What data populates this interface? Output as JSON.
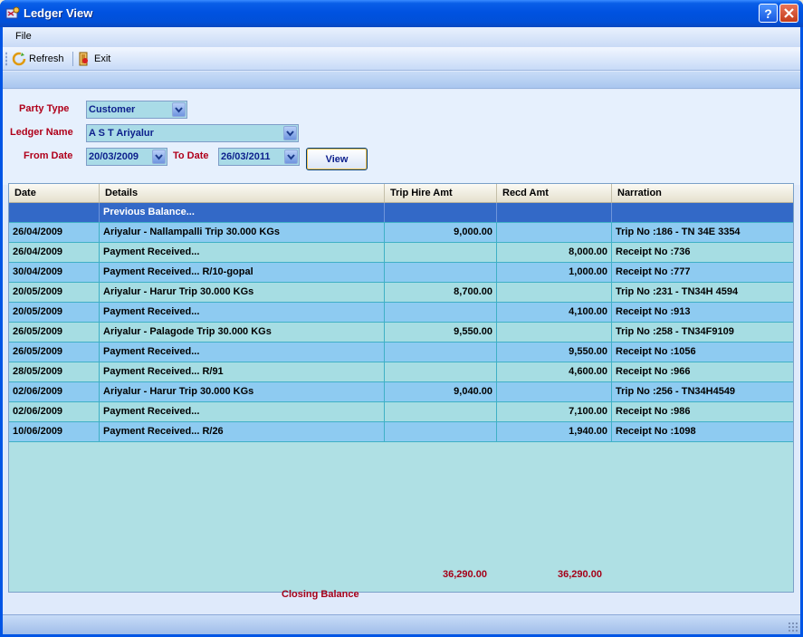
{
  "window": {
    "title": "Ledger View"
  },
  "menu": {
    "file": "File"
  },
  "toolbar": {
    "refresh": "Refresh",
    "exit": "Exit"
  },
  "form": {
    "party_type_label": "Party Type",
    "party_type_value": "Customer",
    "ledger_name_label": "Ledger Name",
    "ledger_name_value": "A S T Ariyalur",
    "from_date_label": "From Date",
    "from_date_value": "20/03/2009",
    "to_date_label": "To Date",
    "to_date_value": "26/03/2011",
    "view_button": "View"
  },
  "grid": {
    "columns": {
      "date": "Date",
      "details": "Details",
      "trip_hire_amt": "Trip Hire Amt",
      "recd_amt": "Recd Amt",
      "narration": "Narration"
    },
    "rows": [
      {
        "date": "",
        "details": "Previous Balance...",
        "trip": "",
        "recd": "",
        "narration": "",
        "style": "sel"
      },
      {
        "date": "26/04/2009",
        "details": "Ariyalur - Nallampalli Trip 30.000 KGs",
        "trip": "9,000.00",
        "recd": "",
        "narration": "Trip No :186 - TN 34E 3354",
        "style": "blue"
      },
      {
        "date": "26/04/2009",
        "details": "Payment Received...",
        "trip": "",
        "recd": "8,000.00",
        "narration": "Receipt No :736",
        "style": "teal"
      },
      {
        "date": "30/04/2009",
        "details": "Payment Received... R/10-gopal",
        "trip": "",
        "recd": "1,000.00",
        "narration": "Receipt No :777",
        "style": "blue"
      },
      {
        "date": "20/05/2009",
        "details": "Ariyalur - Harur Trip 30.000 KGs",
        "trip": "8,700.00",
        "recd": "",
        "narration": "Trip No :231 - TN34H 4594",
        "style": "teal"
      },
      {
        "date": "20/05/2009",
        "details": "Payment Received...",
        "trip": "",
        "recd": "4,100.00",
        "narration": "Receipt No :913",
        "style": "blue"
      },
      {
        "date": "26/05/2009",
        "details": "Ariyalur - Palagode Trip 30.000 KGs",
        "trip": "9,550.00",
        "recd": "",
        "narration": "Trip No :258 - TN34F9109",
        "style": "teal"
      },
      {
        "date": "26/05/2009",
        "details": "Payment Received...",
        "trip": "",
        "recd": "9,550.00",
        "narration": "Receipt No :1056",
        "style": "blue"
      },
      {
        "date": "28/05/2009",
        "details": "Payment Received... R/91",
        "trip": "",
        "recd": "4,600.00",
        "narration": "Receipt No :966",
        "style": "teal"
      },
      {
        "date": "02/06/2009",
        "details": "Ariyalur - Harur Trip 30.000 KGs",
        "trip": "9,040.00",
        "recd": "",
        "narration": "Trip No :256 - TN34H4549",
        "style": "blue"
      },
      {
        "date": "02/06/2009",
        "details": "Payment Received...",
        "trip": "",
        "recd": "7,100.00",
        "narration": "Receipt No :986",
        "style": "teal"
      },
      {
        "date": "10/06/2009",
        "details": "Payment Received... R/26",
        "trip": "",
        "recd": "1,940.00",
        "narration": "Receipt No :1098",
        "style": "blue"
      }
    ]
  },
  "totals": {
    "trip_hire_total": "36,290.00",
    "recd_total": "36,290.00",
    "closing_balance_label": "Closing Balance"
  },
  "colors": {
    "label_red": "#b0001a",
    "row_blue": "#8ecbf1",
    "row_teal": "#a6dde3",
    "selected_row": "#3369c7"
  }
}
